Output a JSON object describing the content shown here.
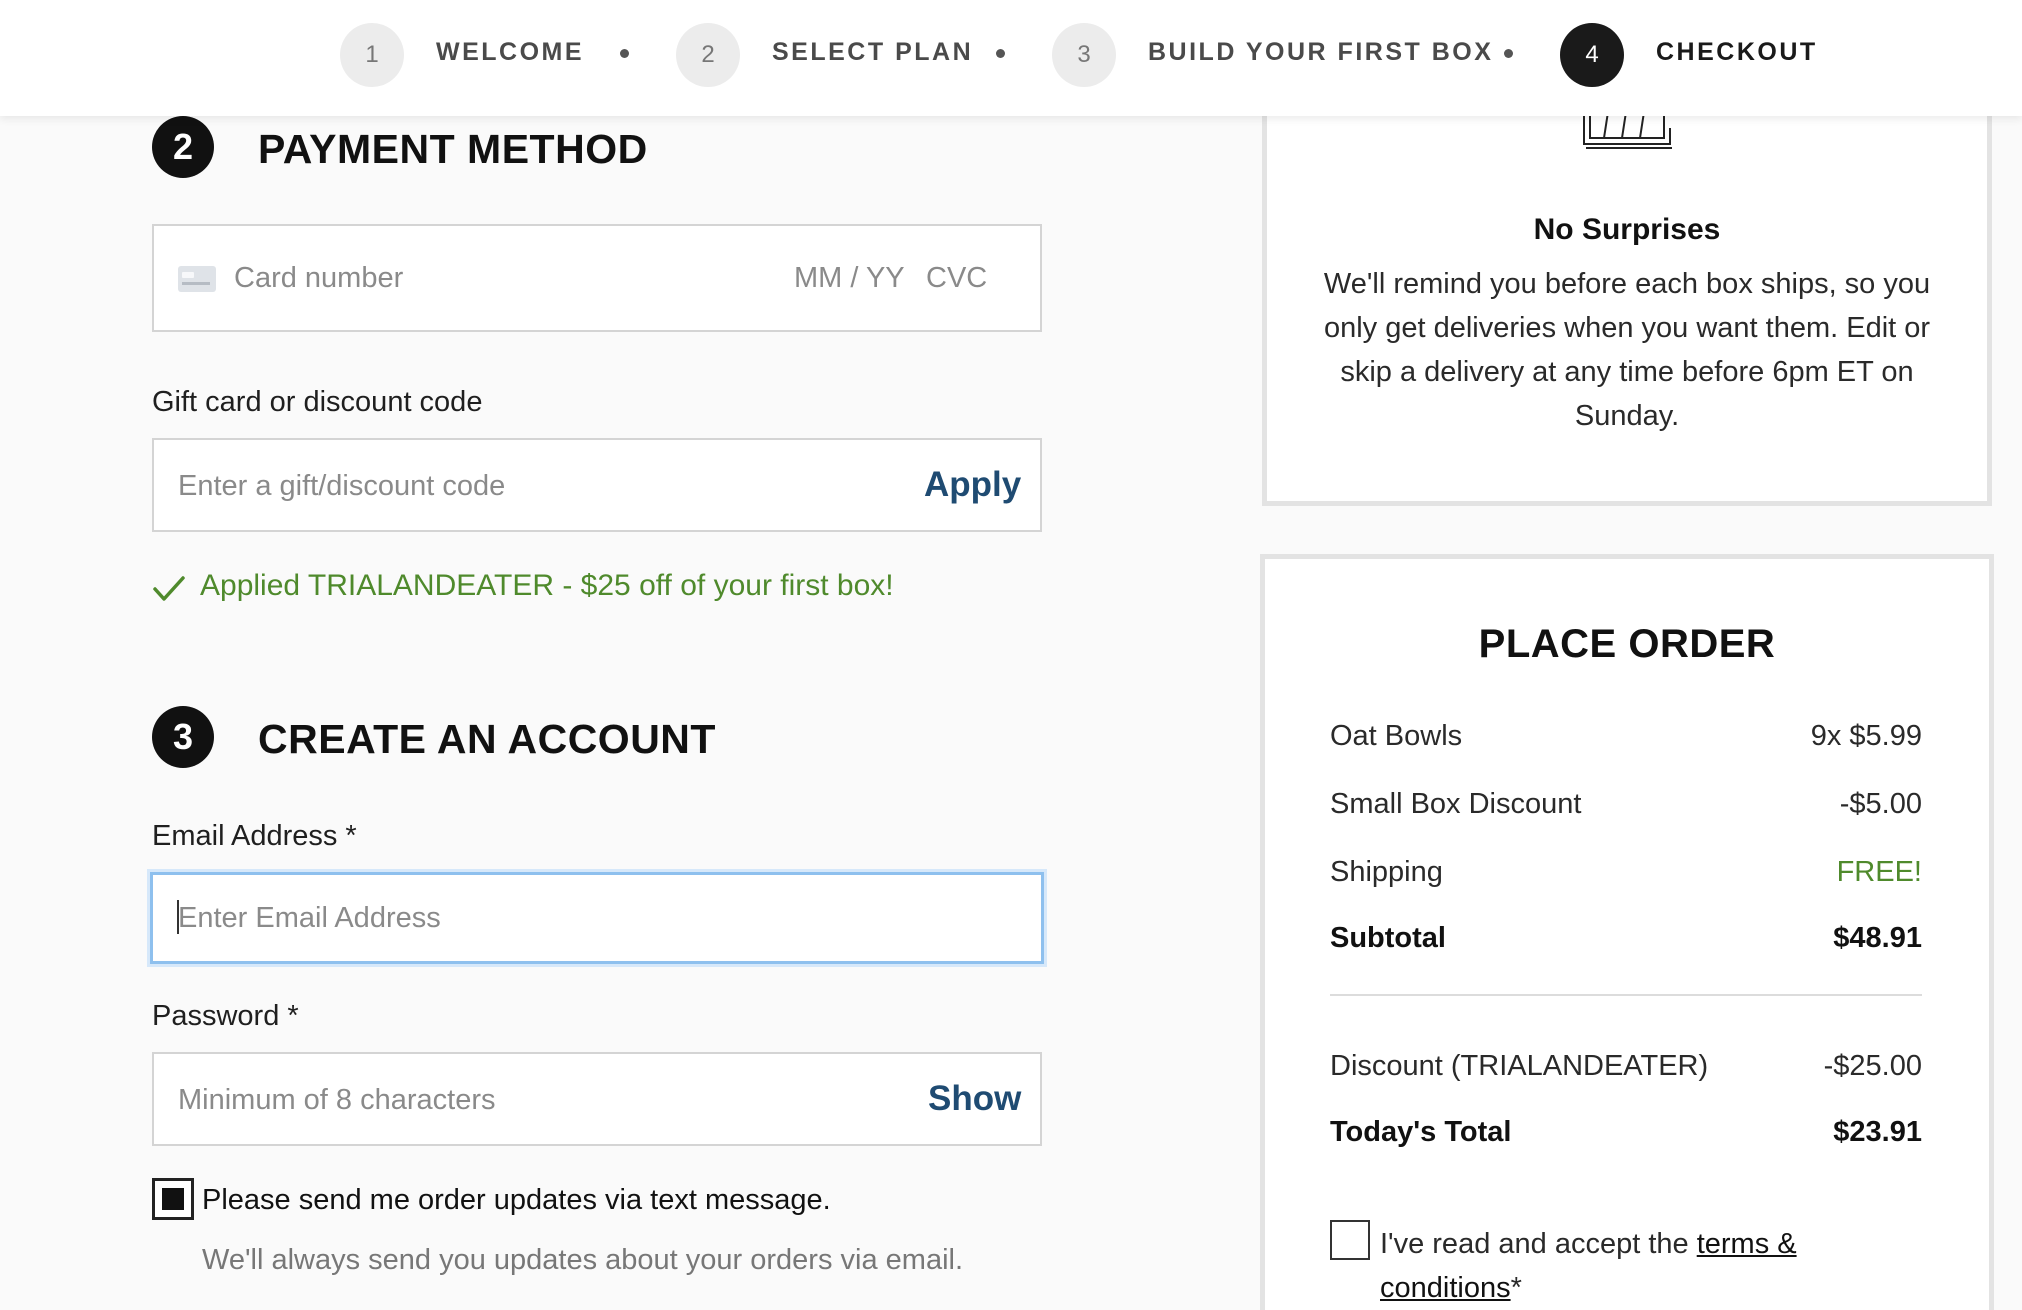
{
  "progress": {
    "steps": [
      {
        "number": "1",
        "label": "WELCOME"
      },
      {
        "number": "2",
        "label": "SELECT PLAN"
      },
      {
        "number": "3",
        "label": "BUILD YOUR FIRST BOX"
      },
      {
        "number": "4",
        "label": "CHECKOUT"
      }
    ],
    "active_step": 4
  },
  "payment": {
    "section_number": "2",
    "title": "PAYMENT METHOD",
    "card_number_placeholder": "Card number",
    "expiry_placeholder": "MM / YY",
    "cvc_placeholder": "CVC",
    "gift_label": "Gift card or discount code",
    "gift_placeholder": "Enter a gift/discount code",
    "apply_label": "Apply",
    "applied_message": "Applied TRIALANDEATER - $25 off of your first box!"
  },
  "account": {
    "section_number": "3",
    "title": "CREATE AN ACCOUNT",
    "email_label": "Email Address *",
    "email_placeholder": "Enter Email Address",
    "password_label": "Password *",
    "password_placeholder": "Minimum of 8 characters",
    "show_label": "Show",
    "sms_optin_label": "Please send me order updates via text message.",
    "sms_optin_checked": true,
    "email_note": "We'll always send you updates about your orders via email."
  },
  "info_panel": {
    "title": "No Surprises",
    "body": "We'll remind you before each box ships, so you only get deliveries when you want them. Edit or skip a delivery at any time before 6pm ET on Sunday."
  },
  "order": {
    "title": "PLACE ORDER",
    "lines": [
      {
        "label": "Oat Bowls",
        "value": "9x $5.99"
      },
      {
        "label": "Small Box Discount",
        "value": "-$5.00"
      },
      {
        "label": "Shipping",
        "value": "FREE!"
      },
      {
        "label": "Subtotal",
        "value": "$48.91"
      },
      {
        "label": "Discount (TRIALANDEATER)",
        "value": "-$25.00"
      },
      {
        "label": "Today's Total",
        "value": "$23.91"
      }
    ],
    "terms_prefix": "I've read and accept the",
    "terms_link": "terms & conditions",
    "terms_suffix": "*",
    "terms_checked": false
  },
  "colors": {
    "success_green": "#4f8a2c",
    "link_blue": "#1f4b72",
    "focus_blue": "#8ec0ee"
  }
}
